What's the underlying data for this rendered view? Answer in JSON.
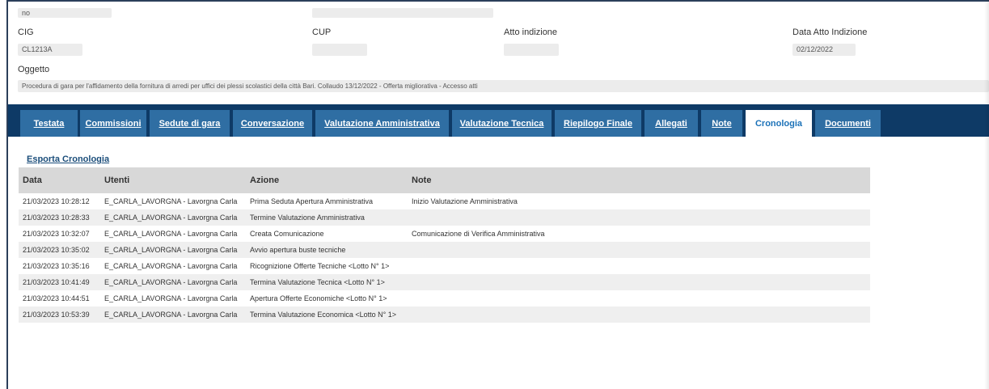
{
  "top_fields": {
    "partial_value": "no"
  },
  "fields": {
    "cig_label": "CIG",
    "cig_value": "CL1213A",
    "cup_label": "CUP",
    "cup_value": "",
    "atto_indizione_label": "Atto indizione",
    "atto_indizione_value": "",
    "data_atto_label": "Data Atto Indizione",
    "data_atto_value": "02/12/2022",
    "oggetto_label": "Oggetto",
    "oggetto_value": "Procedura di gara per l'affidamento della fornitura di arredi per uffici dei plessi scolastici della città Bari. Collaudo 13/12/2022 - Offerta migliorativa - Accesso atti"
  },
  "tabs": [
    {
      "label": "Testata",
      "active": false
    },
    {
      "label": "Commissioni",
      "active": false
    },
    {
      "label": "Sedute di gara",
      "active": false
    },
    {
      "label": "Conversazione",
      "active": false
    },
    {
      "label": "Valutazione Amministrativa",
      "active": false
    },
    {
      "label": "Valutazione Tecnica",
      "active": false
    },
    {
      "label": "Riepilogo Finale",
      "active": false
    },
    {
      "label": "Allegati",
      "active": false
    },
    {
      "label": "Note",
      "active": false
    },
    {
      "label": "Cronologia",
      "active": true
    },
    {
      "label": "Documenti",
      "active": false
    }
  ],
  "export_link": "Esporta Cronologia",
  "table": {
    "headers": [
      "Data",
      "Utenti",
      "Azione",
      "Note"
    ],
    "rows": [
      [
        "21/03/2023 10:28:12",
        "E_CARLA_LAVORGNA - Lavorgna Carla",
        "Prima Seduta Apertura Amministrativa",
        "Inizio Valutazione Amministrativa"
      ],
      [
        "21/03/2023 10:28:33",
        "E_CARLA_LAVORGNA - Lavorgna Carla",
        "Termine Valutazione Amministrativa",
        ""
      ],
      [
        "21/03/2023 10:32:07",
        "E_CARLA_LAVORGNA - Lavorgna Carla",
        "Creata Comunicazione",
        "Comunicazione di Verifica Amministrativa"
      ],
      [
        "21/03/2023 10:35:02",
        "E_CARLA_LAVORGNA - Lavorgna Carla",
        "Avvio apertura buste tecniche",
        ""
      ],
      [
        "21/03/2023 10:35:16",
        "E_CARLA_LAVORGNA - Lavorgna Carla",
        "Ricognizione Offerte Tecniche <Lotto N° 1>",
        ""
      ],
      [
        "21/03/2023 10:41:49",
        "E_CARLA_LAVORGNA - Lavorgna Carla",
        "Termina Valutazione Tecnica <Lotto N° 1>",
        ""
      ],
      [
        "21/03/2023 10:44:51",
        "E_CARLA_LAVORGNA - Lavorgna Carla",
        "Apertura Offerte Economiche <Lotto N° 1>",
        ""
      ],
      [
        "21/03/2023 10:53:39",
        "E_CARLA_LAVORGNA - Lavorgna Carla",
        "Termina Valutazione Economica <Lotto N° 1>",
        ""
      ]
    ]
  },
  "colors": {
    "tabbar_bg": "#0e3a66",
    "tab_bg": "#2f6ea3",
    "tab_active_text": "#1c72b8",
    "link": "#1a4d7a"
  }
}
